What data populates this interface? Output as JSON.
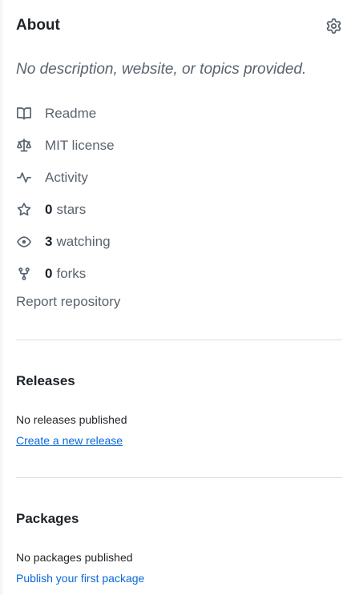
{
  "about": {
    "title": "About",
    "settings_icon": "gear-icon",
    "description": "No description, website, or topics provided.",
    "items": [
      {
        "icon": "book-icon",
        "count": "",
        "label": "Readme"
      },
      {
        "icon": "law-icon",
        "count": "",
        "label": "MIT license"
      },
      {
        "icon": "pulse-icon",
        "count": "",
        "label": "Activity"
      },
      {
        "icon": "star-icon",
        "count": "0",
        "label": "stars"
      },
      {
        "icon": "eye-icon",
        "count": "3",
        "label": "watching"
      },
      {
        "icon": "fork-icon",
        "count": "0",
        "label": "forks"
      }
    ],
    "report": "Report repository"
  },
  "releases": {
    "title": "Releases",
    "status": "No releases published",
    "link": "Create a new release"
  },
  "packages": {
    "title": "Packages",
    "status": "No packages published",
    "link": "Publish your first package"
  },
  "colors": {
    "text": "#1f2328",
    "muted": "#59636e",
    "link": "#0969da",
    "divider": "#d8dee4"
  }
}
